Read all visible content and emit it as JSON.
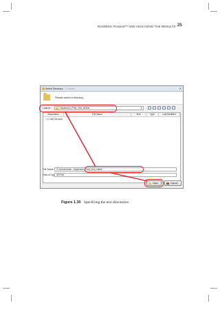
{
  "header": {
    "running_head": "RUNNING Proseed™ AND ANALYZING THE RESULTS",
    "page_number": "25"
  },
  "dialog": {
    "title": "Select Directory",
    "title_sub": "C:\\Users\\...",
    "banner_text": "Please select a directory",
    "look_in_label": "Look In:",
    "look_in_value": "Hystereon_Pmd_Xlst_Hotels",
    "columns": [
      "Bookmarks",
      "File Name",
      "Size",
      "Type",
      "Last Modified"
    ],
    "bookmark_item": "= 1 List(Columns)",
    "file_name_label": "File Name:",
    "file_name_value": "C:\\Users\\name\\...\\Hystereon_Pmd_Xlst_Hotels",
    "files_of_type_label": "Files of Type:",
    "files_of_type_value": "All Files",
    "open_button": "Open",
    "cancel_button": "Cancel"
  },
  "figure": {
    "label": "Figure 1.30",
    "text": "Specifying the text directories"
  },
  "colors": {
    "highlight": "#e0202a",
    "folder": "#e6c05a"
  }
}
